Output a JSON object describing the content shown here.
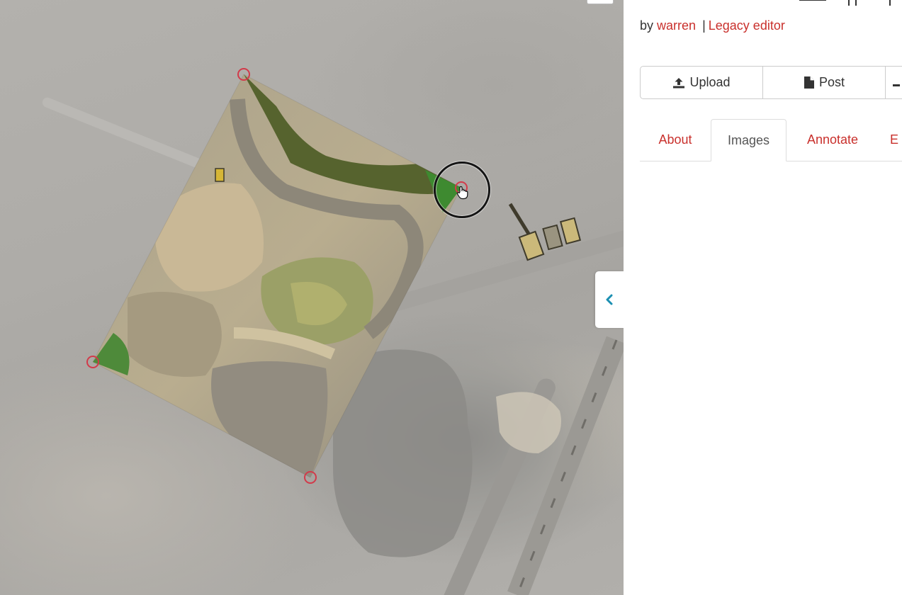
{
  "sidebar": {
    "byline": {
      "prefix": "by",
      "author": "warren",
      "separator": "|",
      "editor_link": "Legacy editor"
    },
    "buttons": {
      "upload": "Upload",
      "post": "Post"
    },
    "tabs": [
      {
        "label": "About",
        "active": false
      },
      {
        "label": "Images",
        "active": true
      },
      {
        "label": "Annotate",
        "active": false
      },
      {
        "label": "E",
        "active": false
      }
    ]
  },
  "colors": {
    "link": "#c9302c",
    "handle": "#d23a4a",
    "toggle_chevron": "#1b8fb2"
  },
  "icons": {
    "upload": "upload-icon",
    "post": "document-icon",
    "collapse": "chevron-left-icon",
    "cursor": "hand-pointer-icon"
  }
}
